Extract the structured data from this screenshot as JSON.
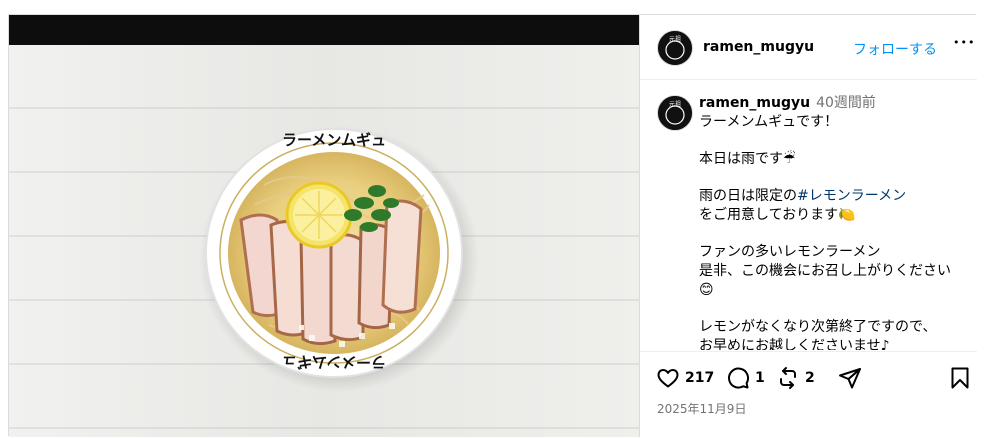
{
  "post": {
    "username": "ramen_mugyu",
    "follow_label": "フォローする",
    "more_label": "•••",
    "time_ago": "40週間前",
    "date": "2025年11月9日",
    "avatar_text": "元祖"
  },
  "image": {
    "bowl_text_top": "ラーメンムギュ",
    "bowl_text_bottom": "ラーメンムギュ"
  },
  "caption": {
    "line1": "ラーメンムギュです！",
    "line2": "本日は雨です☔",
    "line3_prefix": "雨の日は限定の",
    "line3_hashtag": "#レモンラーメン",
    "line4": "をご用意しております🍋",
    "line5": "ファンの多いレモンラーメン",
    "line6": "是非、この機会にお召し上がりください",
    "line7": "😊",
    "line8": "レモンがなくなり次第終了ですので、",
    "line9": "お早めにお越しくださいませ♪"
  },
  "stats": {
    "likes": "217",
    "comments": "1",
    "reposts": "2"
  },
  "icons": {
    "like": "heart-icon",
    "comment": "comment-bubble-icon",
    "repost": "repost-icon",
    "share": "share-send-icon",
    "save": "bookmark-icon"
  }
}
